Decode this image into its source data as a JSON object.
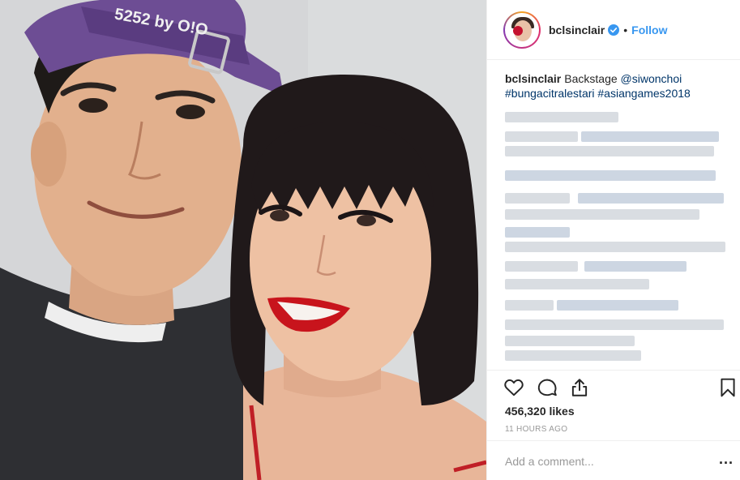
{
  "post": {
    "username": "bclsinclair",
    "follow_label": "Follow",
    "separator": "•",
    "caption_username": "bclsinclair",
    "caption_text": "Backstage",
    "mention": "@siwonchoi",
    "hashtags": "#bungacitralestari #asiangames2018",
    "likes": "456,320 likes",
    "timestamp": "11 HOURS AGO",
    "cap_text": "5252 by O!O"
  },
  "comment": {
    "placeholder": "Add a comment...",
    "more_label": "..."
  },
  "icons": {
    "like": "heart-icon",
    "comment": "comment-icon",
    "share": "share-icon",
    "save": "bookmark-icon",
    "verified": "verified-badge-icon"
  },
  "colors": {
    "accent": "#3897f0",
    "link": "#003569",
    "meta": "#999999",
    "border": "#efefef"
  }
}
